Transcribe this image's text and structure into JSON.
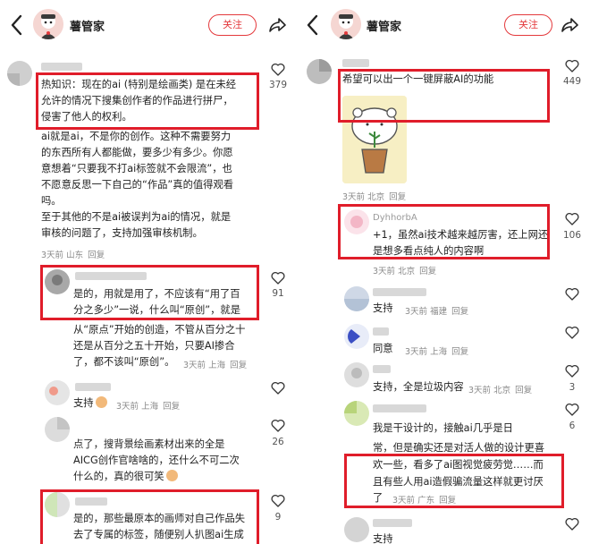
{
  "left": {
    "header": {
      "name": "薯管家",
      "follow_label": "关注"
    },
    "comments": [
      {
        "lines": [
          "热知识：现在的ai (特别是绘画类) 是在未经",
          "允许的情况下搜集创作者的作品进行拼尸，",
          "侵害了他人的权利。",
          "ai就是ai，不是你的创作。这种不需要努力",
          "的东西所有人都能做，要多少有多少。你愿",
          "意想着“只要我不打ai标签就不会限流”，也",
          "不愿意反思一下自己的“作品”真的值得观看",
          "吗。",
          "至于其他的不是ai被误判为ai的情况，就是",
          "审核的问题了，支持加强审核机制。"
        ],
        "meta": "3天前 山东",
        "reply": "回复",
        "likes": "379"
      },
      {
        "lines": [
          "是的，用就是用了，不应该有“用了百",
          "分之多少”一说，什么叫“原创”，就是",
          "从“原点”开始的创造，不管从百分之十",
          "还是从百分之五十开始，只要AI掺合",
          "了，都不该叫“原创”。"
        ],
        "meta": "3天前 上海",
        "reply": "回复",
        "likes": "91"
      },
      {
        "text": "支持",
        "meta": "3天前 上海",
        "reply": "回复",
        "likes": ""
      },
      {
        "lines": [
          "点了，搜背景绘画素材出来的全是",
          "AICG创作官啥啥的，还什么不可二次",
          "什么的，真的很可笑"
        ],
        "meta": "",
        "likes": "26"
      },
      {
        "lines": [
          "是的，那些最原本的画师对自己作品失",
          "去了专属的标签，随便别人扒图ai生成"
        ],
        "likes": "9"
      }
    ]
  },
  "right": {
    "header": {
      "name": "薯管家",
      "follow_label": "关注"
    },
    "comments": [
      {
        "text": "希望可以出一个一键屏蔽AI的功能",
        "meta": "3天前 北京",
        "reply": "回复",
        "likes": "449"
      },
      {
        "username": "DyhhorbA",
        "lines": [
          "+1，虽然ai技术越来越厉害，还上网还",
          "是想多看点纯人的内容啊"
        ],
        "meta": "3天前 北京",
        "reply": "回复",
        "likes": "106"
      },
      {
        "text": "支持",
        "meta": "3天前 福建",
        "reply": "回复",
        "likes": ""
      },
      {
        "text": "同意",
        "meta": "3天前 上海",
        "reply": "回复",
        "likes": ""
      },
      {
        "text": "支持，全是垃圾内容",
        "meta": "3天前 北京",
        "reply": "回复",
        "likes": "3"
      },
      {
        "lines": [
          "我是干设计的，接触ai几乎是日",
          "常，但是确实还是对活人做的设计更喜",
          "欢一些，看多了ai图视觉疲劳觉……而",
          "且有些人用ai造假骗流量这样就更讨厌",
          "了"
        ],
        "meta": "3天前 广东",
        "reply": "回复",
        "likes": "6"
      },
      {
        "text": "支持",
        "likes": ""
      }
    ]
  },
  "colors": {
    "accent": "#e4393c",
    "highlight": "#e01d2a",
    "meta": "#8a8a8a"
  },
  "icons": {
    "back": "chevron-left-icon",
    "share": "share-icon",
    "like": "heart-icon"
  }
}
